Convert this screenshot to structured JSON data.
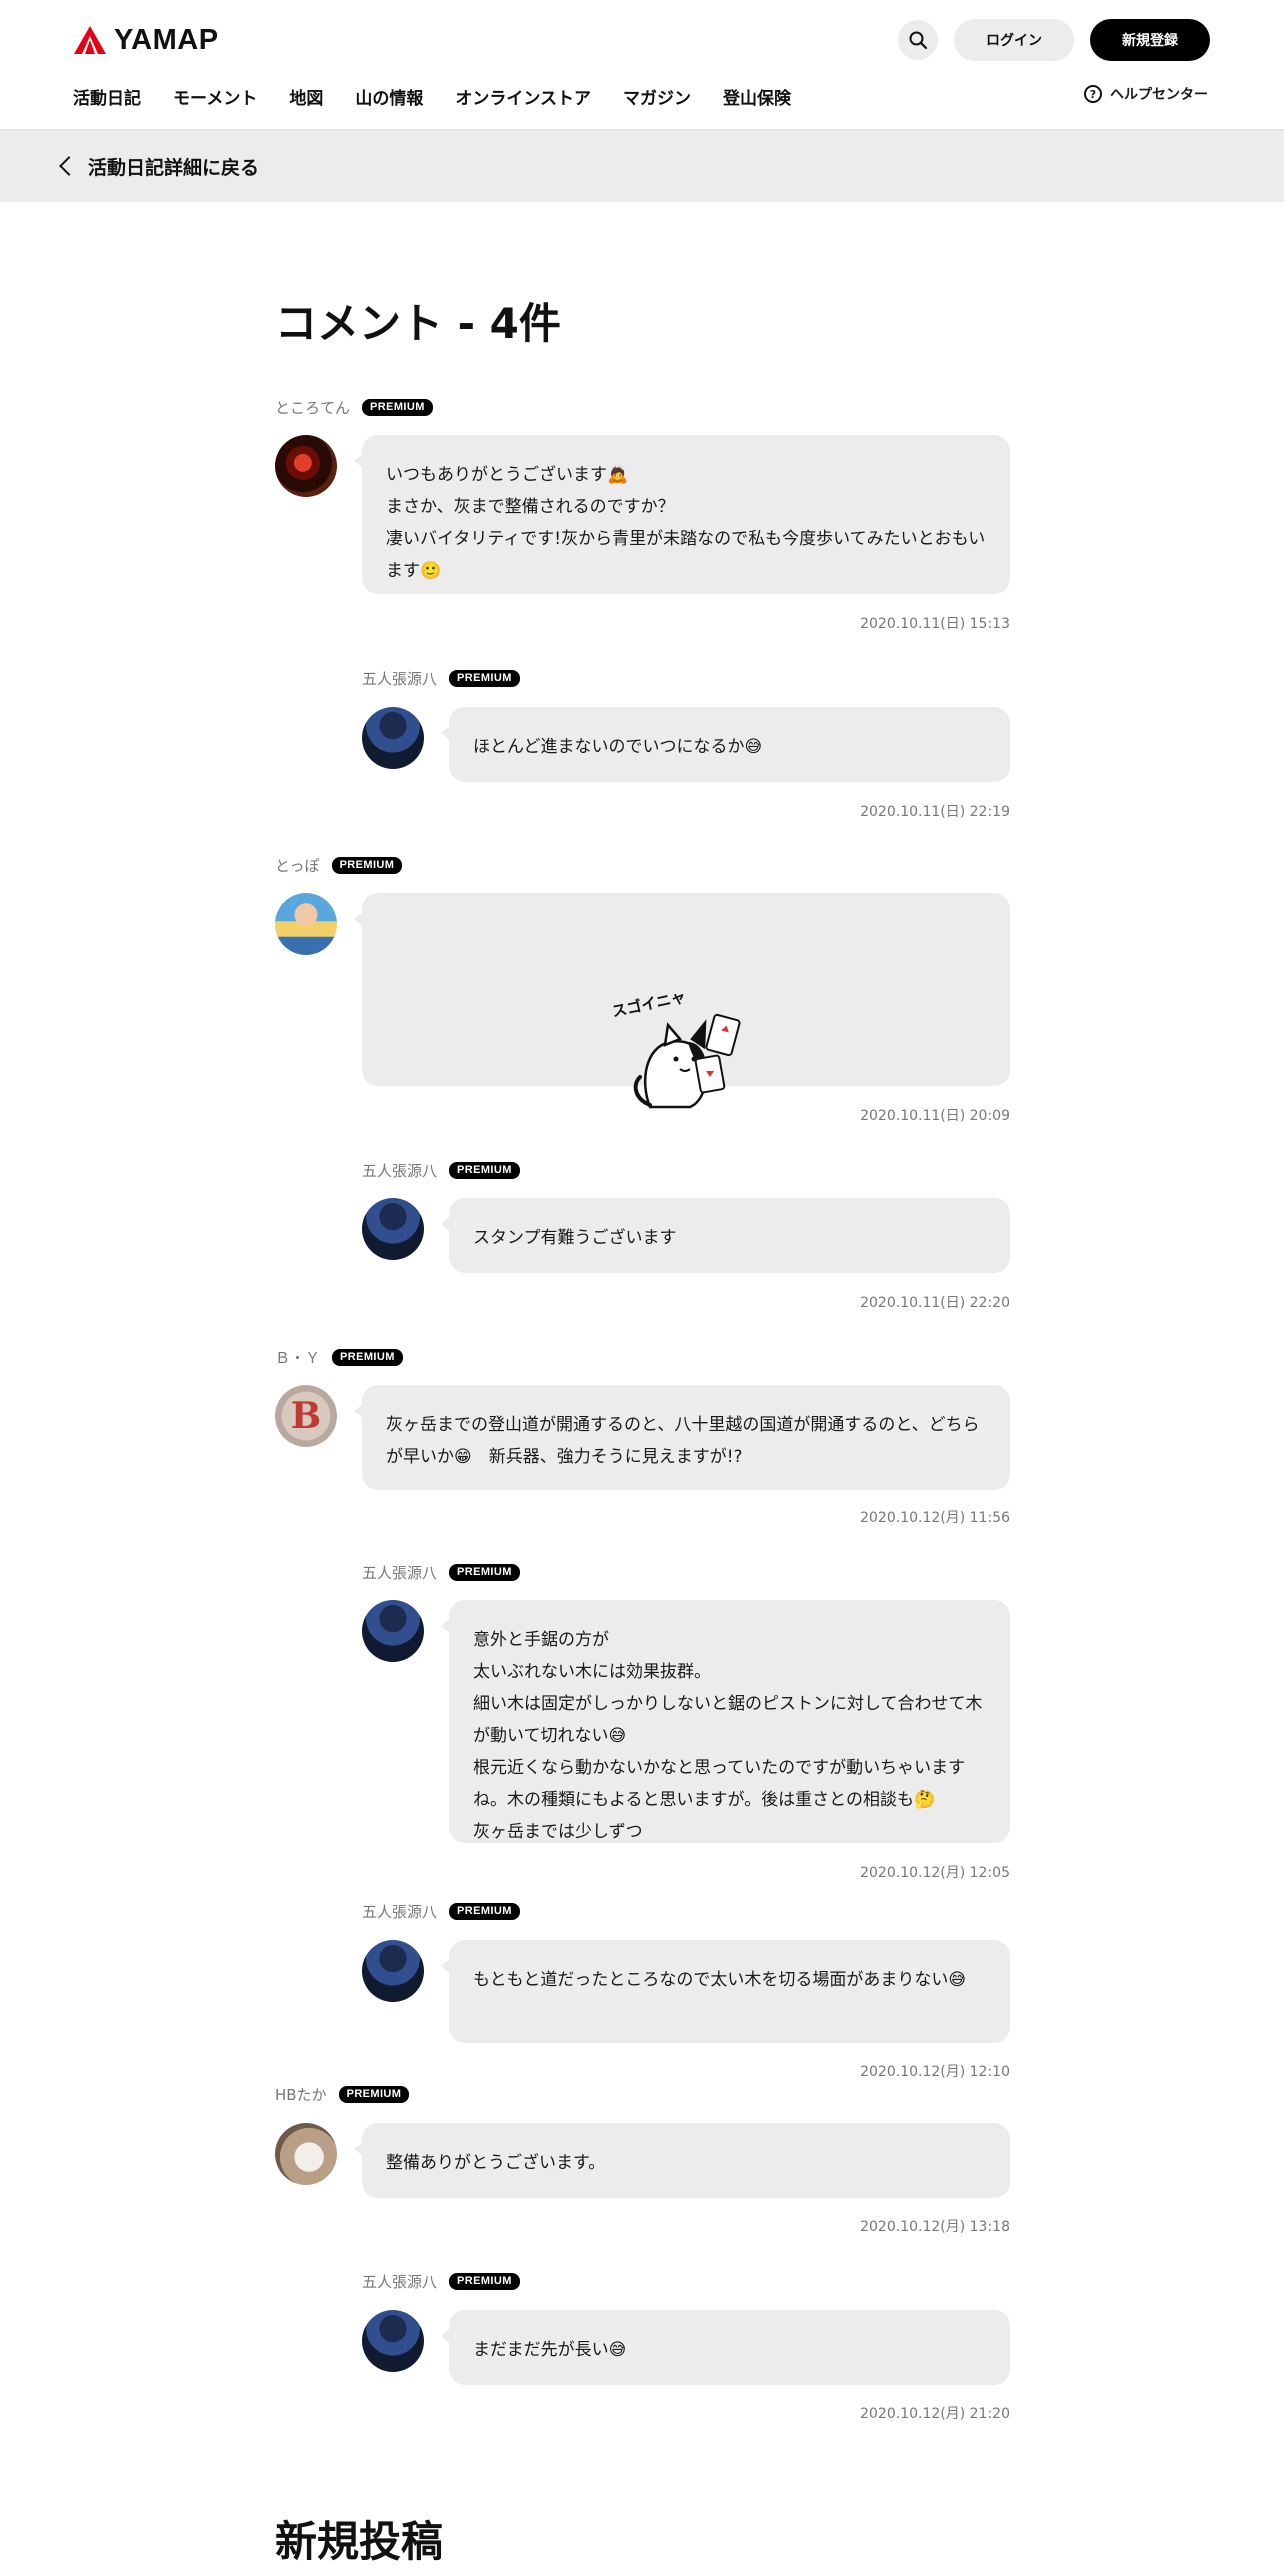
{
  "header": {
    "logo_text": "YAMAP",
    "login_label": "ログイン",
    "signup_label": "新規登録",
    "nav": [
      "活動日記",
      "モーメント",
      "地図",
      "山の情報",
      "オンラインストア",
      "マガジン",
      "登山保険"
    ],
    "help_label": "ヘルプセンター",
    "brand_red": "#e60012"
  },
  "back": {
    "label": "活動日記詳細に戻る"
  },
  "comments_title": "コメント - 4件",
  "new_post_title": "新規投稿",
  "badge": "PREMIUM",
  "comments": [
    {
      "name": "ところてん",
      "text": "いつもありがとうございます🙇\nまさか、灰まで整備されるのですか？\n凄いバイタリティです!灰から青里が未踏なので私も今度歩いてみたいとおもいます🙂",
      "time": "2020.10.11(日) 15:13"
    },
    {
      "name": "五人張源八",
      "text": "ほとんど進まないのでいつになるか😅",
      "time": "2020.10.11(日) 22:19"
    },
    {
      "name": "とっぽ",
      "sticker": "スゴイニャ",
      "time": "2020.10.11(日) 20:09"
    },
    {
      "name": "五人張源八",
      "text": "スタンプ有難うございます",
      "time": "2020.10.11(日) 22:20"
    },
    {
      "name": "Ｂ・Ｙ",
      "text": "灰ヶ岳までの登山道が開通するのと、八十里越の国道が開通するのと、どちらが早いか😁　新兵器、強力そうに見えますが!?",
      "time": "2020.10.12(月) 11:56"
    },
    {
      "name": "五人張源八",
      "text": "意外と手鋸の方が\n太いぶれない木には効果抜群。\n細い木は固定がしっかりしないと鋸のピストンに対して合わせて木が動いて切れない😅\n根元近くなら動かないかなと思っていたのですが動いちゃいますね。木の種類にもよると思いますが。後は重さとの相談も🤔\n灰ヶ岳までは少しずつ",
      "time": "2020.10.12(月) 12:05"
    },
    {
      "name": "五人張源八",
      "text": "もともと道だったところなので太い木を切る場面があまりない😅",
      "time": "2020.10.12(月) 12:10"
    },
    {
      "name": "HBたか",
      "text": "整備ありがとうございます。",
      "time": "2020.10.12(月) 13:18"
    },
    {
      "name": "五人張源八",
      "text": "まだまだ先が長い😅",
      "time": "2020.10.12(月) 21:20"
    }
  ]
}
